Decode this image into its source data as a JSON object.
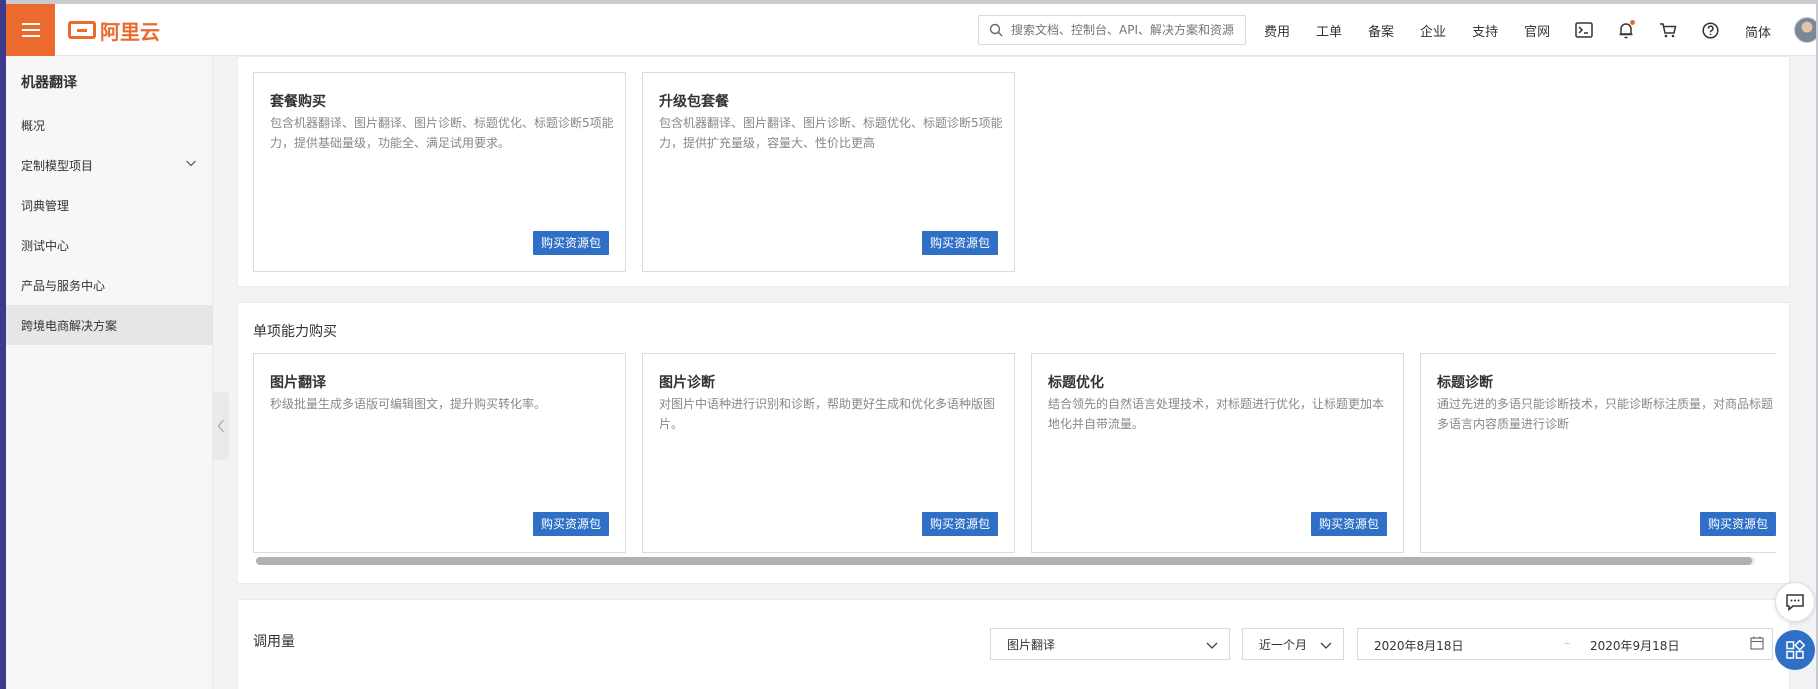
{
  "header": {
    "logo_text": "阿里云",
    "search_placeholder": "搜索文档、控制台、API、解决方案和资源",
    "nav_links": [
      "费用",
      "工单",
      "备案",
      "企业",
      "支持",
      "官网"
    ],
    "lang": "简体",
    "icons": [
      "terminal-icon",
      "bell-icon",
      "cart-icon",
      "help-icon"
    ]
  },
  "sidebar": {
    "title": "机器翻译",
    "items": [
      {
        "label": "概况"
      },
      {
        "label": "定制模型项目"
      },
      {
        "label": "词典管理"
      },
      {
        "label": "测试中心"
      },
      {
        "label": "产品与服务中心"
      },
      {
        "label": "跨境电商解决方案"
      }
    ]
  },
  "package_cards": [
    {
      "title": "套餐购买",
      "desc": "包含机器翻译、图片翻译、图片诊断、标题优化、标题诊断5项能力，提供基础量级，功能全、满足试用要求。",
      "button": "购买资源包"
    },
    {
      "title": "升级包套餐",
      "desc": "包含机器翻译、图片翻译、图片诊断、标题优化、标题诊断5项能力，提供扩充量级，容量大、性价比更高",
      "button": "购买资源包"
    }
  ],
  "single_section": {
    "title": "单项能力购买",
    "cards": [
      {
        "title": "图片翻译",
        "desc": "秒级批量生成多语版可编辑图文，提升购买转化率。",
        "button": "购买资源包"
      },
      {
        "title": "图片诊断",
        "desc": "对图片中语种进行识别和诊断，帮助更好生成和优化多语种版图片。",
        "button": "购买资源包"
      },
      {
        "title": "标题优化",
        "desc": "结合领先的自然语言处理技术，对标题进行优化，让标题更加本地化并自带流量。",
        "button": "购买资源包"
      },
      {
        "title": "标题诊断",
        "desc": "通过先进的多语只能诊断技术，只能诊断标注质量，对商品标题多语言内容质量进行诊断",
        "button": "购买资源包"
      }
    ]
  },
  "usage": {
    "title": "调用量",
    "service_select": "图片翻译",
    "period_select": "近一个月",
    "date_start": "2020年8月18日",
    "date_sep": "–",
    "date_end": "2020年9月18日"
  }
}
